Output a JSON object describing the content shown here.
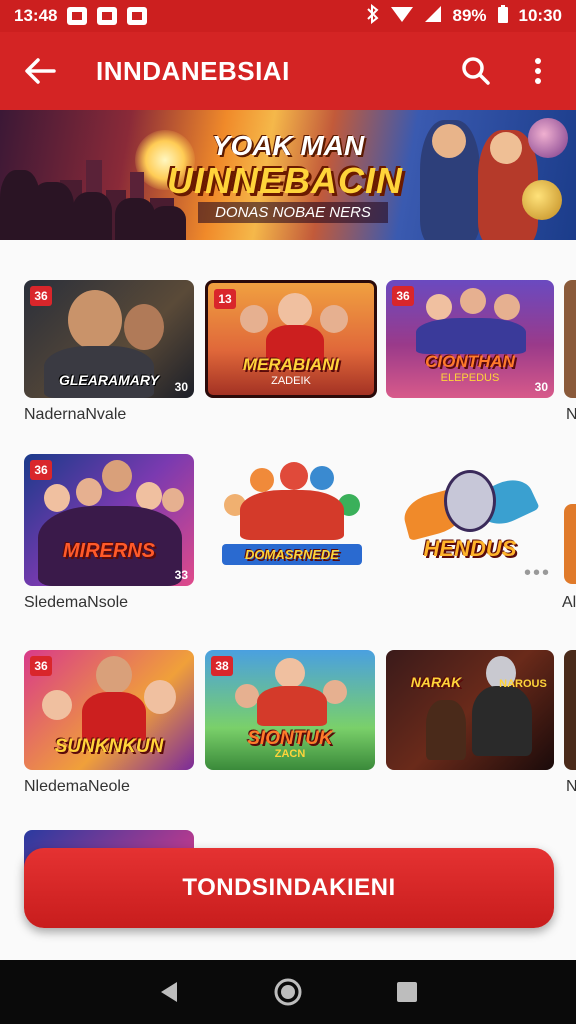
{
  "status_bar": {
    "time_left": "13:48",
    "battery": "89%",
    "time_right": "10:30"
  },
  "app_bar": {
    "title": "INNDANEBSIAI"
  },
  "banner": {
    "title": "YOAK MAN",
    "headline": "UINNEBACIN",
    "subtitle": "DONAS NOBAE NERS"
  },
  "rows": [
    {
      "caption": "NadernaNvale",
      "cards": [
        {
          "badge": "36",
          "label": "GLEARAMARY",
          "num": "30"
        },
        {
          "badge": "13",
          "label": "MERABIANI",
          "sub": "ZADEIK"
        },
        {
          "badge": "36",
          "label": "CIONTHAN",
          "sub": "ELEPEDUS",
          "num": "30"
        }
      ]
    },
    {
      "caption": "SledemaNsole",
      "cards": [
        {
          "badge": "36",
          "label": "MIRERNS",
          "num": "33"
        },
        {
          "label": "DOMASRNEDE"
        },
        {
          "label": "HENDUS"
        }
      ]
    },
    {
      "caption": "NledemaNeole",
      "cards": [
        {
          "badge": "36",
          "label": "SUNKNKUN"
        },
        {
          "badge": "38",
          "label": "SIONTUK",
          "sub": "ZACN"
        },
        {
          "label": "NARAK",
          "sub": "NAROUS"
        }
      ]
    }
  ],
  "peek_captions": [
    "N",
    "Al",
    "N"
  ],
  "cta": {
    "label": "TONDSINDAKIENI"
  },
  "colors": {
    "primary_red": "#d42424",
    "status_red": "#cc1f1f",
    "nav_black": "#0a0a0a"
  }
}
